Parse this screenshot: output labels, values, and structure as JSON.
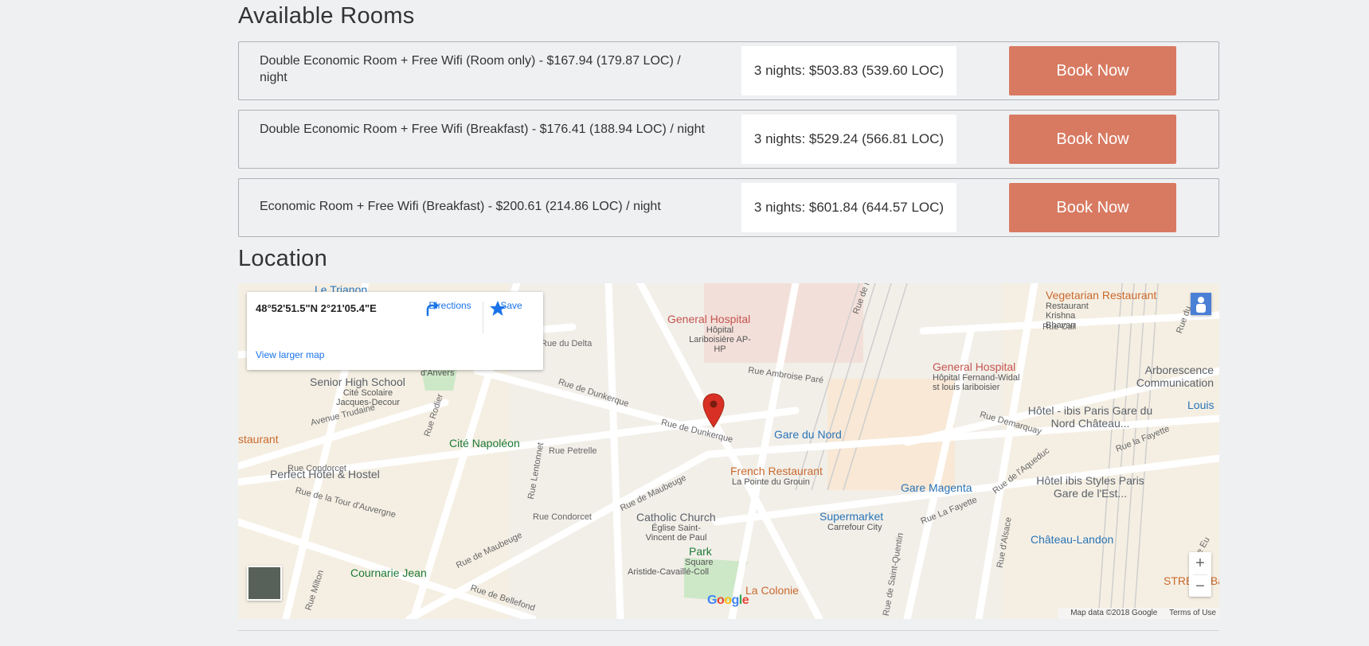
{
  "available_rooms_title": "Available Rooms",
  "location_title": "Location",
  "rooms": [
    {
      "description": "Double Economic Room + Free Wifi (Room only) - $167.94 (179.87 LOC) / night",
      "total": "3 nights: $503.83 (539.60 LOC)",
      "button": "Book Now"
    },
    {
      "description": "Double Economic Room + Free Wifi (Breakfast) - $176.41 (188.94 LOC) / night",
      "total": "3 nights: $529.24 (566.81 LOC)",
      "button": "Book Now"
    },
    {
      "description": "Economic Room + Free Wifi (Breakfast) - $200.61 (214.86 LOC) / night",
      "total": "3 nights: $601.84 (644.57 LOC)",
      "button": "Book Now"
    }
  ],
  "map": {
    "info_card": {
      "coords": "48°52'51.5\"N 2°21'05.4\"E",
      "directions": "Directions",
      "save": "Save",
      "view_larger": "View larger map"
    },
    "labels": {
      "general_hospital_1": "General Hospital",
      "hopital_lariboisiere": "Hôpital Lariboisière AP-HP",
      "senior_high_school": "Senior High School",
      "cite_scolaire": "Cité Scolaire Jacques-Decour",
      "anvers": "d'Anvers",
      "cite_napoleon": "Cité Napoléon",
      "gare_du_nord": "Gare du Nord",
      "vegetarian_restaurant": "Vegetarian Restaurant",
      "restaurant_krishna": "Restaurant Krishna Bhavan",
      "general_hospital_2": "General Hospital",
      "hopital_fernand": "Hôpital Fernand-Widal st louis lariboisier",
      "arborescence": "Arborescence Communication",
      "louis": "Louis",
      "hotel_ibis_gare": "Hôtel - ibis Paris Gare du Nord Château...",
      "restaurant_left": "staurant",
      "perfect_hotel": "Perfect Hôtel & Hostel",
      "french_restaurant": "French Restaurant",
      "la_pointe": "La Pointe du Grouin",
      "gare_magenta": "Gare Magenta",
      "hotel_ibis_styles": "Hôtel ibis Styles Paris Gare de l'Est...",
      "catholic_church": "Catholic Church",
      "eglise": "Église Saint-Vincent de Paul",
      "supermarket": "Supermarket",
      "carrefour": "Carrefour City",
      "chateau_landon": "Château-Landon",
      "park": "Park",
      "square": "Square",
      "aristide": "Aristide-Cavaillé-Coll",
      "cournarie": "Cournarie Jean",
      "la_colonie": "La Colonie",
      "street_bang": "STREET Bang",
      "le_trianon": "Le Trianon"
    },
    "streets": {
      "rue_du_delta": "Rue du Delta",
      "rue_ambroise_pare": "Rue Ambroise Paré",
      "rue_de_dunkerque_1": "Rue de Dunkerque",
      "rue_de_dunkerque_2": "Rue de Dunkerque",
      "avenue_trudaine": "Avenue Trudaine",
      "rue_rodier": "Rue Rodier",
      "rue_petrelle": "Rue Petrelle",
      "rue_condorcet_1": "Rue Condorcet",
      "rue_condorcet_2": "Rue Condorcet",
      "rue_de_la_tour": "Rue de la Tour d'Auvergne",
      "rue_lentonnet": "Rue Lentonnet",
      "rue_de_maubeuge_1": "Rue de Maubeuge",
      "rue_de_maubeuge_2": "Rue de Maubeuge",
      "rue_milton": "Rue Milton",
      "rue_de_bellefond": "Rue de Bellefond",
      "rue_cail": "Rue Cail",
      "rue_demarquay": "Rue Demarquay",
      "rue_la_fayette_1": "Rue la Fayette",
      "rue_la_fayette_2": "Rue La Fayette",
      "rue_de_laqueduc": "Rue de l'Aqueduc",
      "rue_dalsace": "Rue d'Alsace",
      "rue_saint_quentin": "Rue de Saint-Quentin",
      "rue_du_maubeuge_top": "Rue de M",
      "rue_du_right": "Rue du",
      "rue_eu": "Rue Eu"
    },
    "google_logo": "Google",
    "attribution": "Map data ©2018 Google",
    "terms": "Terms of Use",
    "zoom_in": "+",
    "zoom_out": "−"
  },
  "colors": {
    "book_button": "#d87a61",
    "marker": "#d93025"
  }
}
